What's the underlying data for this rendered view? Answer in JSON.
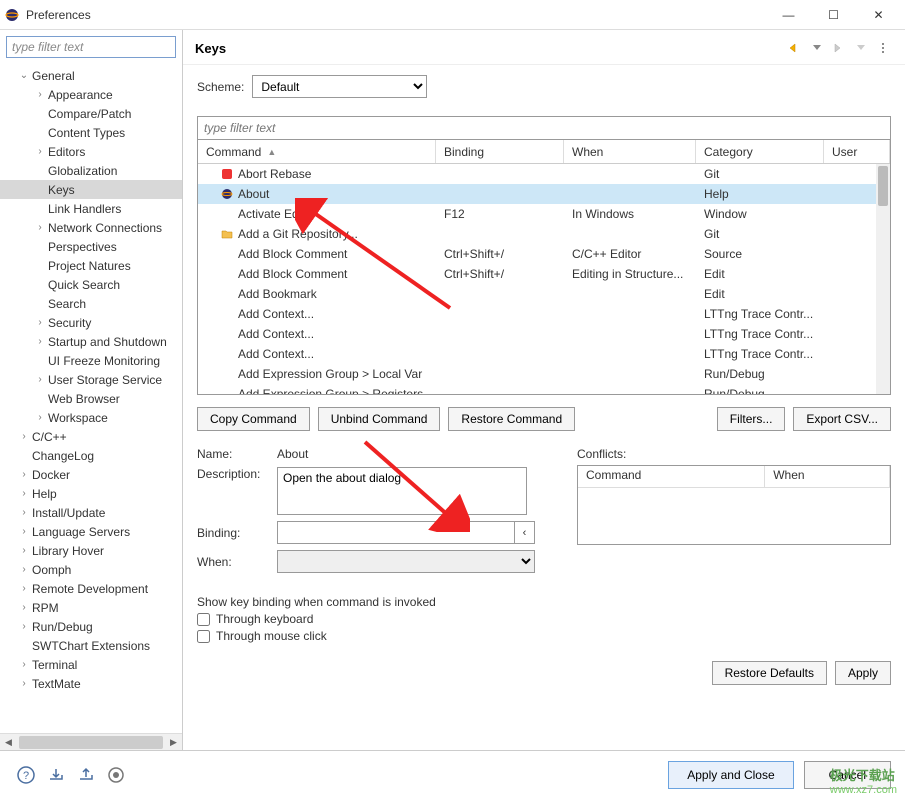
{
  "window": {
    "title": "Preferences"
  },
  "sidebar": {
    "filter_placeholder": "type filter text",
    "items": [
      {
        "lv": 1,
        "exp": "v",
        "label": "General"
      },
      {
        "lv": 2,
        "exp": ">",
        "label": "Appearance"
      },
      {
        "lv": 2,
        "exp": "",
        "label": "Compare/Patch"
      },
      {
        "lv": 2,
        "exp": "",
        "label": "Content Types"
      },
      {
        "lv": 2,
        "exp": ">",
        "label": "Editors"
      },
      {
        "lv": 2,
        "exp": "",
        "label": "Globalization"
      },
      {
        "lv": 2,
        "exp": "",
        "label": "Keys",
        "sel": true
      },
      {
        "lv": 2,
        "exp": "",
        "label": "Link Handlers"
      },
      {
        "lv": 2,
        "exp": ">",
        "label": "Network Connections"
      },
      {
        "lv": 2,
        "exp": "",
        "label": "Perspectives"
      },
      {
        "lv": 2,
        "exp": "",
        "label": "Project Natures"
      },
      {
        "lv": 2,
        "exp": "",
        "label": "Quick Search"
      },
      {
        "lv": 2,
        "exp": "",
        "label": "Search"
      },
      {
        "lv": 2,
        "exp": ">",
        "label": "Security"
      },
      {
        "lv": 2,
        "exp": ">",
        "label": "Startup and Shutdown"
      },
      {
        "lv": 2,
        "exp": "",
        "label": "UI Freeze Monitoring"
      },
      {
        "lv": 2,
        "exp": ">",
        "label": "User Storage Service"
      },
      {
        "lv": 2,
        "exp": "",
        "label": "Web Browser"
      },
      {
        "lv": 2,
        "exp": ">",
        "label": "Workspace"
      },
      {
        "lv": 1,
        "exp": ">",
        "label": "C/C++"
      },
      {
        "lv": 1,
        "exp": "",
        "label": "ChangeLog"
      },
      {
        "lv": 1,
        "exp": ">",
        "label": "Docker"
      },
      {
        "lv": 1,
        "exp": ">",
        "label": "Help"
      },
      {
        "lv": 1,
        "exp": ">",
        "label": "Install/Update"
      },
      {
        "lv": 1,
        "exp": ">",
        "label": "Language Servers"
      },
      {
        "lv": 1,
        "exp": ">",
        "label": "Library Hover"
      },
      {
        "lv": 1,
        "exp": ">",
        "label": "Oomph"
      },
      {
        "lv": 1,
        "exp": ">",
        "label": "Remote Development"
      },
      {
        "lv": 1,
        "exp": ">",
        "label": "RPM"
      },
      {
        "lv": 1,
        "exp": ">",
        "label": "Run/Debug"
      },
      {
        "lv": 1,
        "exp": "",
        "label": "SWTChart Extensions"
      },
      {
        "lv": 1,
        "exp": ">",
        "label": "Terminal"
      },
      {
        "lv": 1,
        "exp": ">",
        "label": "TextMate"
      }
    ]
  },
  "page": {
    "title": "Keys",
    "scheme_label": "Scheme:",
    "scheme_value": "Default",
    "table_filter_placeholder": "type filter text",
    "columns": {
      "command": "Command",
      "binding": "Binding",
      "when": "When",
      "category": "Category",
      "user": "User"
    },
    "rows": [
      {
        "icon": "red",
        "cmd": "Abort Rebase",
        "bnd": "",
        "when": "",
        "cat": "Git"
      },
      {
        "icon": "eclipse",
        "cmd": "About",
        "bnd": "",
        "when": "",
        "cat": "Help",
        "sel": true
      },
      {
        "icon": "",
        "cmd": "Activate Editor",
        "bnd": "F12",
        "when": "In Windows",
        "cat": "Window"
      },
      {
        "icon": "folder",
        "cmd": "Add a Git Repository...",
        "bnd": "",
        "when": "",
        "cat": "Git"
      },
      {
        "icon": "",
        "cmd": "Add Block Comment",
        "bnd": "Ctrl+Shift+/",
        "when": "C/C++ Editor",
        "cat": "Source"
      },
      {
        "icon": "",
        "cmd": "Add Block Comment",
        "bnd": "Ctrl+Shift+/",
        "when": "Editing in Structure...",
        "cat": "Edit"
      },
      {
        "icon": "",
        "cmd": "Add Bookmark",
        "bnd": "",
        "when": "",
        "cat": "Edit"
      },
      {
        "icon": "",
        "cmd": "Add Context...",
        "bnd": "",
        "when": "",
        "cat": "LTTng Trace Contr..."
      },
      {
        "icon": "",
        "cmd": "Add Context...",
        "bnd": "",
        "when": "",
        "cat": "LTTng Trace Contr..."
      },
      {
        "icon": "",
        "cmd": "Add Context...",
        "bnd": "",
        "when": "",
        "cat": "LTTng Trace Contr..."
      },
      {
        "icon": "",
        "cmd": "Add Expression Group > Local Var",
        "bnd": "",
        "when": "",
        "cat": "Run/Debug"
      },
      {
        "icon": "",
        "cmd": "Add Expression Group > Registers",
        "bnd": "",
        "when": "",
        "cat": "Run/Debug"
      }
    ],
    "buttons": {
      "copy": "Copy Command",
      "unbind": "Unbind Command",
      "restore": "Restore Command",
      "filters": "Filters...",
      "export": "Export CSV..."
    },
    "detail": {
      "name_label": "Name:",
      "name_value": "About",
      "desc_label": "Description:",
      "desc_value": "Open the about dialog",
      "binding_label": "Binding:",
      "binding_value": "",
      "when_label": "When:",
      "conflicts_label": "Conflicts:",
      "conflicts_columns": {
        "command": "Command",
        "when": "When"
      }
    },
    "show_section": {
      "title": "Show key binding when command is invoked",
      "keyboard": "Through keyboard",
      "mouse": "Through mouse click"
    },
    "restore_defaults": "Restore Defaults",
    "apply": "Apply"
  },
  "footer": {
    "apply_close": "Apply and Close",
    "cancel": "Cancel"
  },
  "watermark": {
    "brand": "极光下载站",
    "url": "www.xz7.com"
  }
}
